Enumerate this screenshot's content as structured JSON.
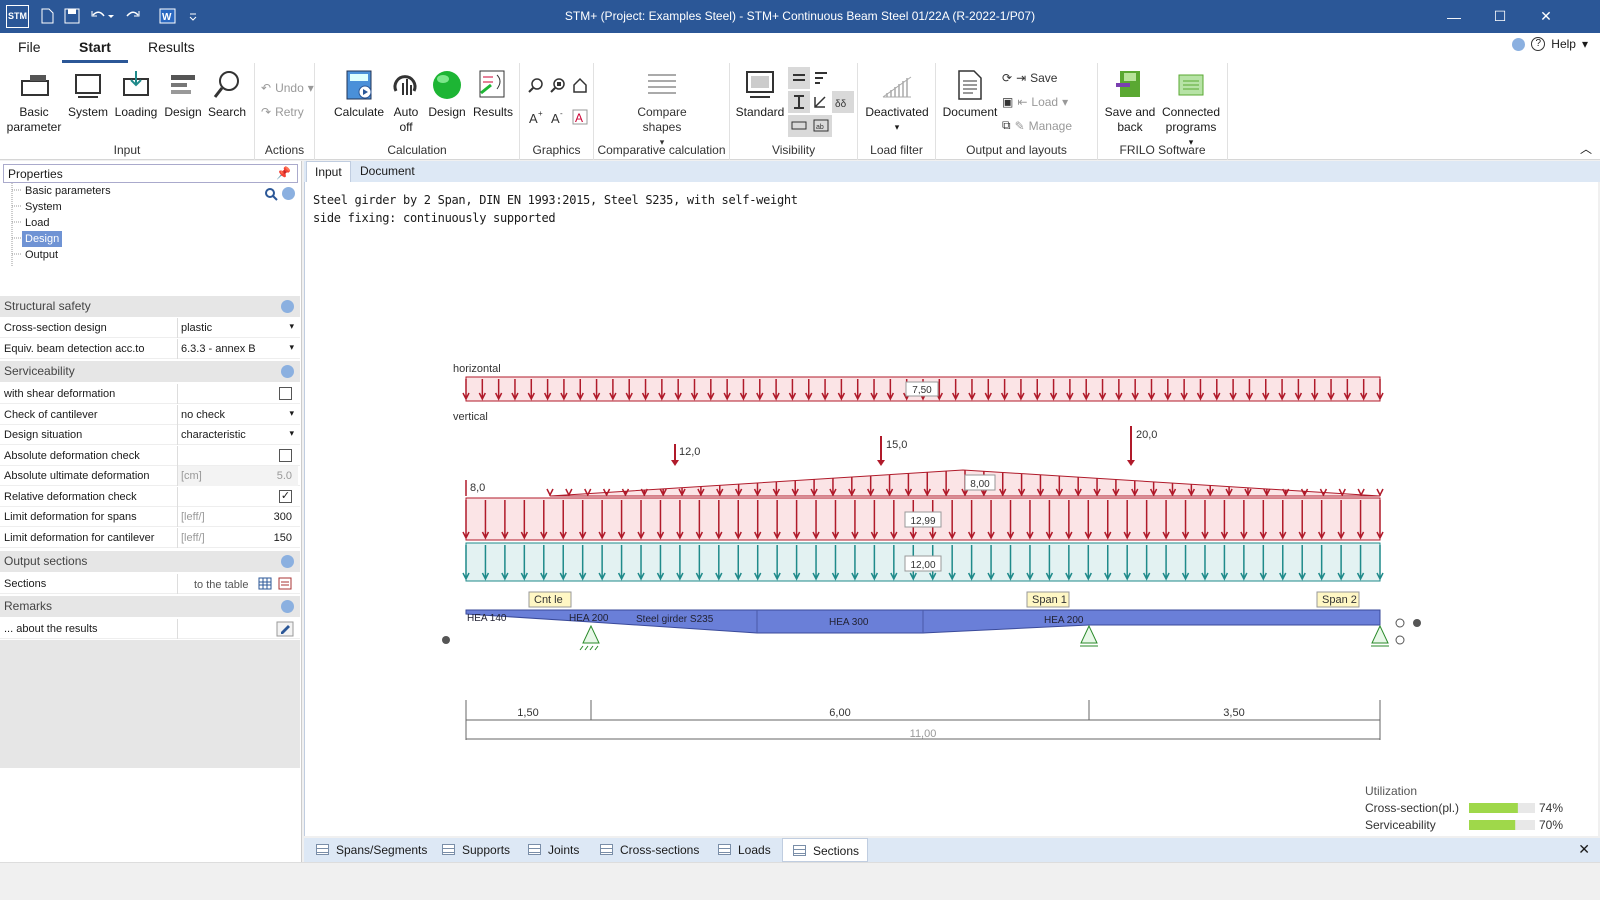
{
  "window": {
    "title": "STM+ (Project: Examples Steel) - STM+ Continuous Beam Steel 01/22A (R-2022-1/P07)",
    "app_icon": "STM"
  },
  "menu": {
    "file": "File",
    "start": "Start",
    "results": "Results",
    "help": "Help"
  },
  "ribbon": {
    "input": {
      "label": "Input",
      "basic_parameter": "Basic parameter",
      "system": "System",
      "loading": "Loading",
      "design": "Design",
      "search": "Search"
    },
    "actions": {
      "label": "Actions",
      "undo": "Undo",
      "retry": "Retry"
    },
    "calculation": {
      "label": "Calculation",
      "calculate": "Calculate",
      "auto_off": "Auto off",
      "design": "Design",
      "results": "Results"
    },
    "graphics": {
      "label": "Graphics"
    },
    "comparative": {
      "label": "Comparative calculation",
      "compare_shapes": "Compare shapes"
    },
    "visibility": {
      "label": "Visibility",
      "standard": "Standard"
    },
    "load_filter": {
      "label": "Load filter",
      "deactivated": "Deactivated"
    },
    "output": {
      "label": "Output and layouts",
      "document": "Document",
      "save": "Save",
      "load": "Load",
      "manage": "Manage"
    },
    "frilo": {
      "label": "FRILO Software",
      "save_and_back": "Save and back",
      "connected_programs": "Connected programs"
    }
  },
  "properties": {
    "header": "Properties",
    "tree": [
      "Basic parameters",
      "System",
      "Load",
      "Design",
      "Output"
    ],
    "selected": "Design",
    "structural_safety": {
      "title": "Structural safety",
      "cross_section_design": {
        "label": "Cross-section design",
        "value": "plastic"
      },
      "equiv_beam": {
        "label": "Equiv. beam detection acc.to",
        "value": "6.3.3 - annex B"
      }
    },
    "serviceability": {
      "title": "Serviceability",
      "shear_deformation": {
        "label": "with shear deformation",
        "checked": false
      },
      "cantilever": {
        "label": "Check of cantilever",
        "value": "no check"
      },
      "design_situation": {
        "label": "Design situation",
        "value": "characteristic"
      },
      "abs_check": {
        "label": "Absolute deformation check",
        "checked": false
      },
      "abs_ult": {
        "label": "Absolute ultimate deformation",
        "unit": "[cm]",
        "value": "5.0"
      },
      "rel_check": {
        "label": "Relative deformation check",
        "checked": true
      },
      "limit_spans": {
        "label": "Limit deformation for spans",
        "unit": "[leff/]",
        "value": "300"
      },
      "limit_cantilever": {
        "label": "Limit deformation for cantilever",
        "unit": "[leff/]",
        "value": "150"
      }
    },
    "output_sections": {
      "title": "Output sections",
      "sections": {
        "label": "Sections",
        "value": "to the table"
      }
    },
    "remarks": {
      "title": "Remarks",
      "about": {
        "label": "... about the results"
      }
    }
  },
  "content_tabs": [
    "Input",
    "Document"
  ],
  "description": {
    "line1": "Steel girder by 2 Span, DIN EN 1993:2015, Steel S235, with self-weight",
    "line2": "side fixing: continuously supported"
  },
  "drawing": {
    "horizontal_label": "horizontal",
    "vertical_label": "vertical",
    "horizontal_load": "7,50",
    "point_loads": [
      "12,0",
      "15,0",
      "20,0"
    ],
    "left_load": "8,0",
    "trapezoid_load": "8,00",
    "uniform_load_1": "12,99",
    "uniform_load_2": "12,00",
    "tags": [
      "Cnt le",
      "Span 1",
      "Span 2"
    ],
    "sections": [
      "HEA 140",
      "HEA 200",
      "Steel girder S235",
      "HEA 300",
      "HEA 200"
    ],
    "dims": [
      "1,50",
      "6,00",
      "3,50"
    ],
    "total": "11,00"
  },
  "utilization": {
    "title": "Utilization",
    "rows": [
      {
        "label": "Cross-section(pl.)",
        "value": "74%",
        "fraction": 0.74
      },
      {
        "label": "Serviceability",
        "value": "70%",
        "fraction": 0.7
      }
    ]
  },
  "bottom_tabs": [
    "Spans/Segments",
    "Supports",
    "Joints",
    "Cross-sections",
    "Loads",
    "Sections"
  ],
  "colors": {
    "titlebar": "#2b5797",
    "load_red": "#b01a2a",
    "load_teal": "#1f8a8a",
    "beam": "#6a7fd8",
    "bar_green": "#9fd84a"
  }
}
